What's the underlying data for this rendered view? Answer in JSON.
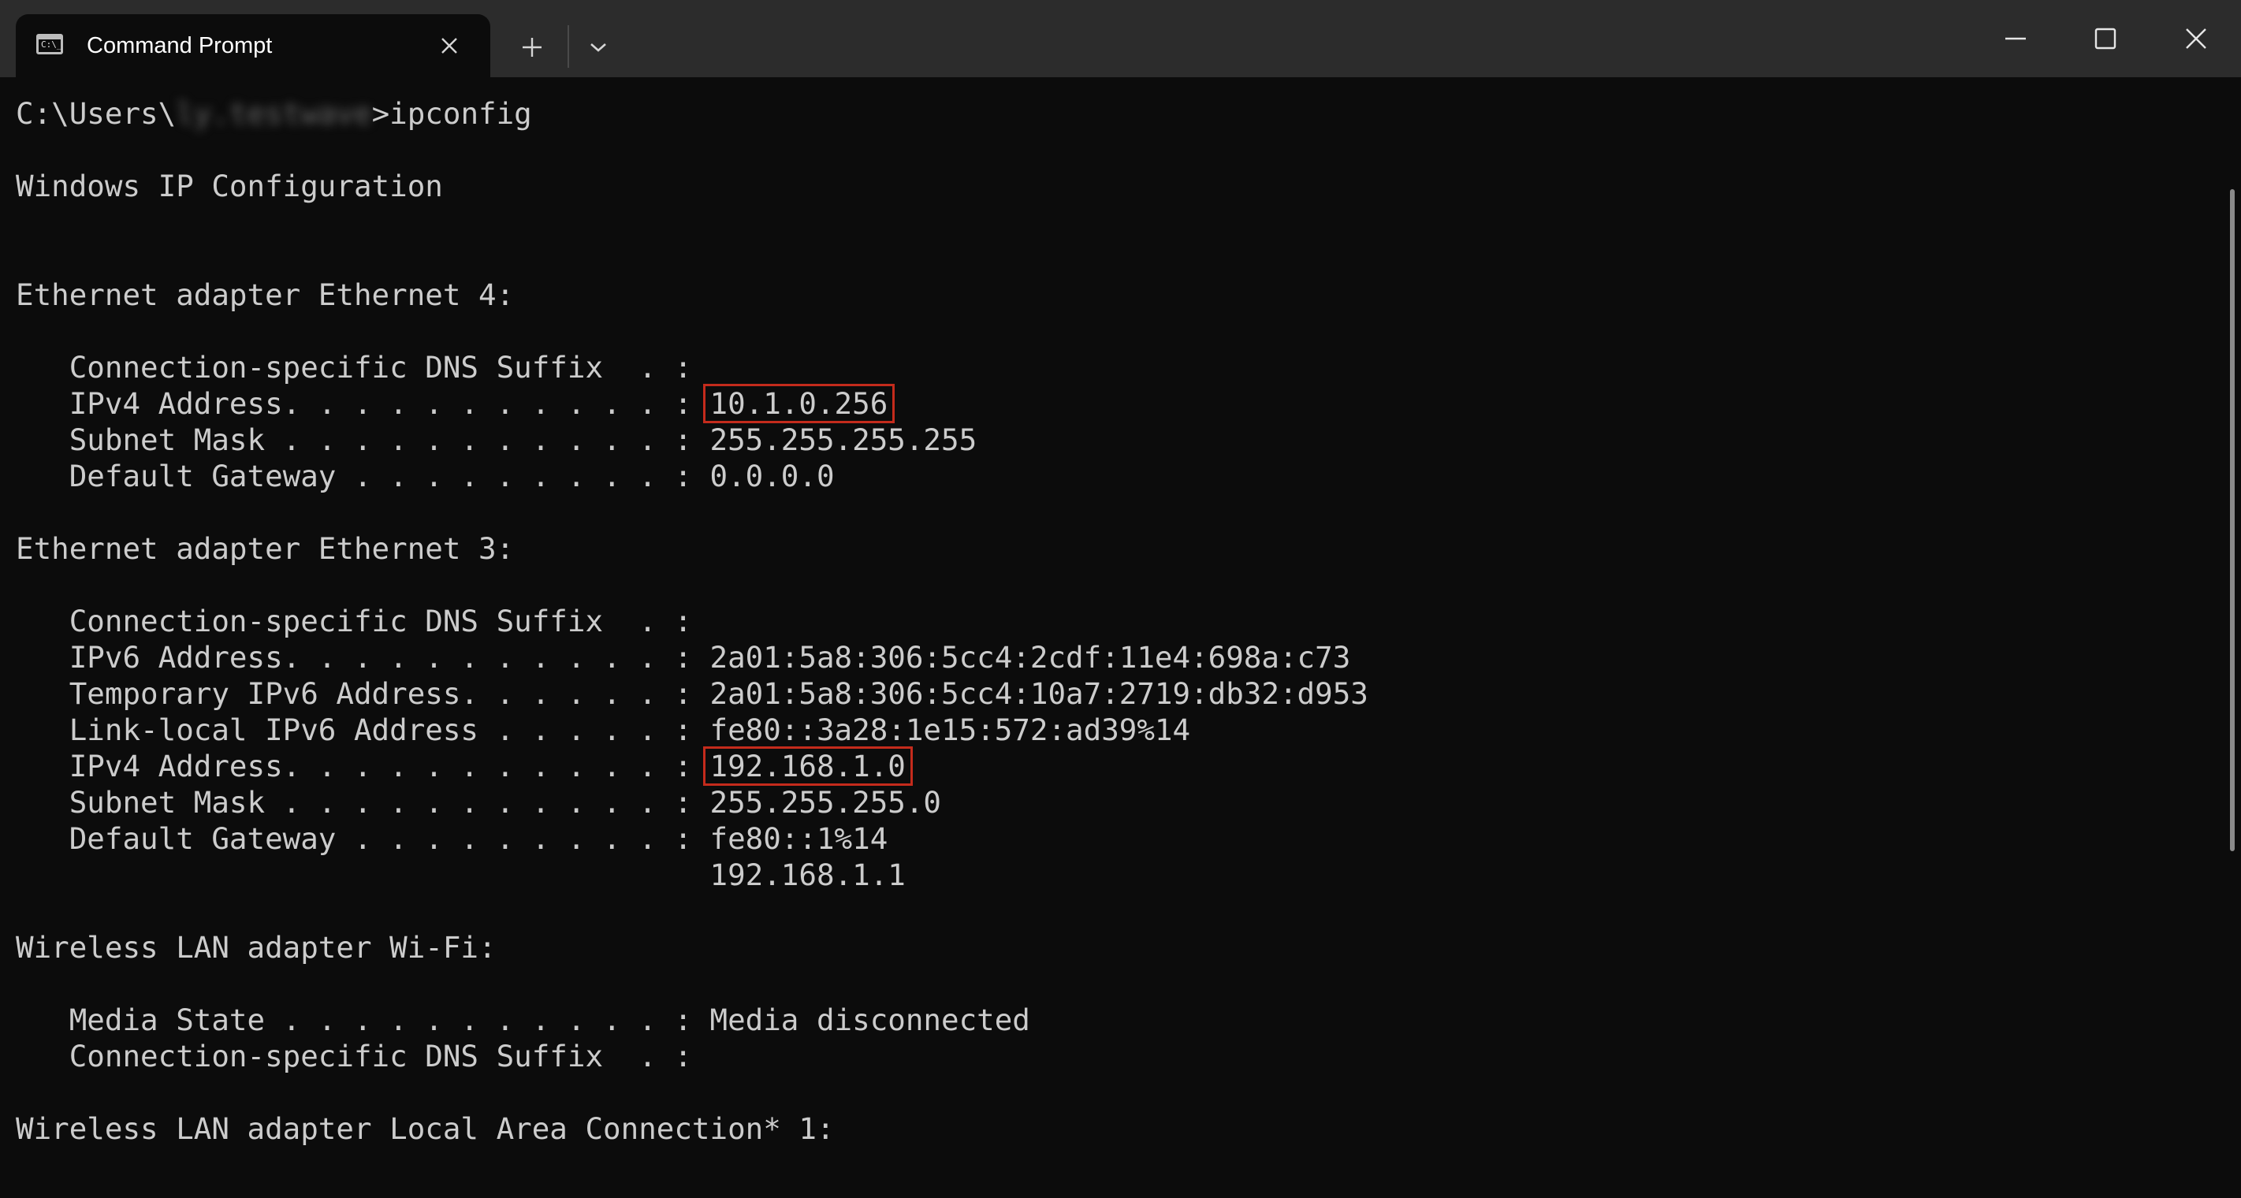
{
  "tab": {
    "title": "Command Prompt",
    "icon": "terminal-icon",
    "icon_glyph": "C:\\_"
  },
  "titlebar": {
    "new_tab_icon": "plus-icon",
    "dropdown_icon": "chevron-down-icon",
    "minimize_icon": "minimize-icon",
    "maximize_icon": "maximize-icon",
    "close_icon": "close-icon"
  },
  "colors": {
    "terminal_bg": "#0c0c0c",
    "titlebar_bg": "#2c2c2c",
    "text": "#cccccc",
    "highlight_box": "#c42b1c"
  },
  "terminal": {
    "prompt_path": "C:\\Users\\",
    "prompt_user": "ly.testwave",
    "prompt_cmd": ">ipconfig",
    "lines": [
      "",
      "Windows IP Configuration",
      "",
      "",
      "Ethernet adapter Ethernet 4:",
      "",
      "   Connection-specific DNS Suffix  . :",
      "   IPv4 Address. . . . . . . . . . . : ",
      "   Subnet Mask . . . . . . . . . . . : 255.255.255.255",
      "   Default Gateway . . . . . . . . . : 0.0.0.0",
      "",
      "Ethernet adapter Ethernet 3:",
      "",
      "   Connection-specific DNS Suffix  . :",
      "   IPv6 Address. . . . . . . . . . . : 2a01:5a8:306:5cc4:2cdf:11e4:698a:c73",
      "   Temporary IPv6 Address. . . . . . : 2a01:5a8:306:5cc4:10a7:2719:db32:d953",
      "   Link-local IPv6 Address . . . . . : fe80::3a28:1e15:572:ad39%14",
      "   IPv4 Address. . . . . . . . . . . : ",
      "   Subnet Mask . . . . . . . . . . . : 255.255.255.0",
      "   Default Gateway . . . . . . . . . : fe80::1%14",
      "                                       192.168.1.1",
      "",
      "Wireless LAN adapter Wi-Fi:",
      "",
      "   Media State . . . . . . . . . . . : Media disconnected",
      "   Connection-specific DNS Suffix  . :",
      "",
      "Wireless LAN adapter Local Area Connection* 1:"
    ],
    "highlighted_ipv4_eth4": "10.1.0.256",
    "highlighted_ipv4_eth3": "192.168.1.0"
  }
}
